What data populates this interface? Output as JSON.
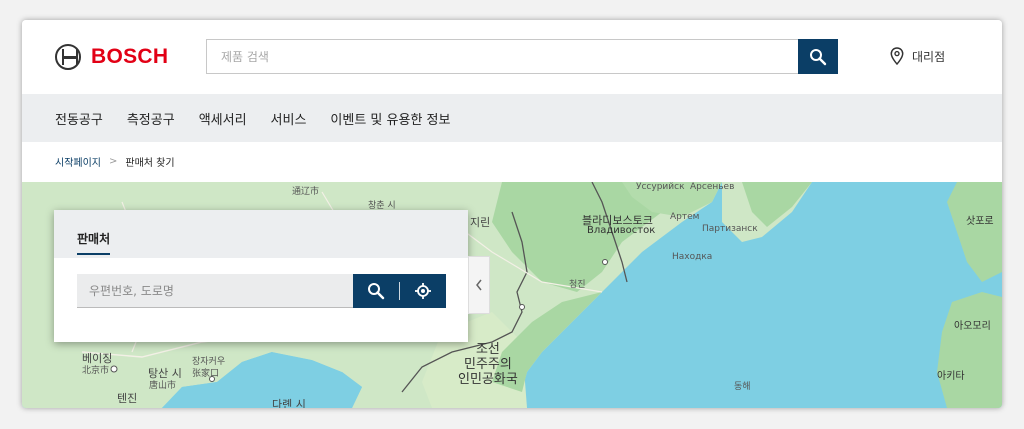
{
  "brand": {
    "name": "BOSCH",
    "color": "#e20015"
  },
  "header": {
    "search_placeholder": "제품 검색",
    "dealer_label": "대리점"
  },
  "nav": {
    "items": [
      "전동공구",
      "측정공구",
      "액세서리",
      "서비스",
      "이벤트 및 유용한 정보"
    ]
  },
  "breadcrumb": {
    "home": "시작페이지",
    "separator": ">",
    "current": "판매처 찾기"
  },
  "panel": {
    "tab_label": "판매처",
    "input_placeholder": "우편번호, 도로명"
  },
  "map": {
    "labels": {
      "tonghua": "通辽市",
      "jilin": "지린",
      "vladivostok_kr": "블라디보스토크",
      "vladivostok_ru": "Владивосток",
      "ussuriysk": "Уссурийск",
      "arsenyev": "Арсеньев",
      "partizansk": "Партизанск",
      "nakhodka": "Находка",
      "artem": "Артем",
      "beijing": "베이징",
      "beijing_cn": "北京市",
      "tianjin": "텐진",
      "tangshan": "탕산 시",
      "tangshan_cn": "唐山市",
      "dalian": "다롄 시",
      "dprk": "조선\n민주주의\n인민공화국",
      "chongjin": "청진",
      "sapporo": "삿포로",
      "aomori": "아오모리",
      "akita": "아키타",
      "east_sea": "동해",
      "zhangjiakou": "장자커우",
      "zhangjiakou_cn": "张家口",
      "changchun": "창춘 시"
    },
    "colors": {
      "water": "#7ecfe3",
      "land": "#cfe7c6",
      "forest": "#a9d7a3"
    }
  },
  "colors": {
    "accent": "#0b3e66",
    "nav_bg": "#eceef0"
  },
  "icons": {
    "search": "search-icon",
    "location_pin": "location-pin-icon",
    "locate": "crosshair-locate-icon",
    "collapse": "chevron-left-icon"
  }
}
